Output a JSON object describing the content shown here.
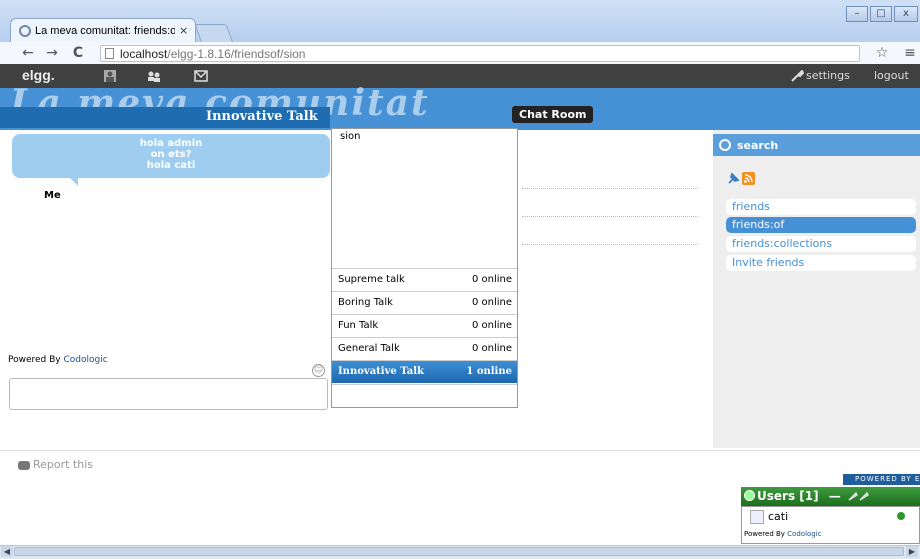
{
  "browser": {
    "tab_title": "La meva comunitat: friends:o",
    "tab_close": "×",
    "url_host": "localhost",
    "url_path": "/elgg-1.8.16/friendsof/sion",
    "window_minimize": "–",
    "window_maximize": "□",
    "window_close": "x",
    "back": "←",
    "forward": "→",
    "reload": "C",
    "star": "☆",
    "menu": "≡"
  },
  "topbar": {
    "logo": "elgg.",
    "settings": "settings",
    "logout": "logout"
  },
  "header": {
    "site_name": "La meva comunitat",
    "chat_title": "Innovative Talk",
    "chat_room_button": "Chat Room"
  },
  "chat": {
    "messages": [
      "hola admin",
      "on ets?",
      "hola cati"
    ],
    "me_label": "Me",
    "powered_prefix": "Powered By",
    "powered_brand": "Codologic",
    "smiley": "☺",
    "input_value": ""
  },
  "rooms": {
    "current_user": "sion",
    "list": [
      {
        "name": "Supreme talk",
        "online": "0 online",
        "active": false
      },
      {
        "name": "Boring Talk",
        "online": "0 online",
        "active": false
      },
      {
        "name": "Fun Talk",
        "online": "0 online",
        "active": false
      },
      {
        "name": "General Talk",
        "online": "0 online",
        "active": false
      },
      {
        "name": "Innovative Talk",
        "online": "1 online",
        "active": true
      }
    ]
  },
  "sidebar": {
    "search_label": "search",
    "menu": [
      {
        "label": "friends",
        "selected": false
      },
      {
        "label": "friends:of",
        "selected": true
      },
      {
        "label": "friends:collections",
        "selected": false
      },
      {
        "label": "Invite friends",
        "selected": false
      }
    ]
  },
  "footer": {
    "report": "Report this",
    "powered_by_elgg": "POWERED BY ELGG"
  },
  "users_widget": {
    "title": "Users [1]",
    "minimize": "—",
    "user_name": "cati",
    "powered_prefix": "Powered By",
    "powered_brand": "Codologic"
  },
  "colors": {
    "header_blue": "#4690d6",
    "topbar_dark": "#404040",
    "active_room": "#1e67ad",
    "users_green": "#1d6f1d"
  }
}
